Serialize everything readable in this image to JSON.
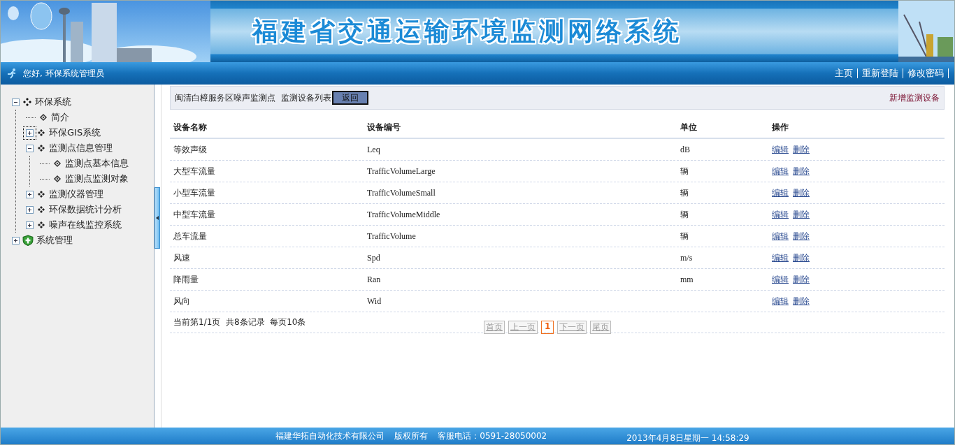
{
  "header": {
    "title": "福建省交通运输环境监测网络系统"
  },
  "nav": {
    "greeting": "您好, 环保系统管理员",
    "links": [
      {
        "label": "主页"
      },
      {
        "label": "重新登陆"
      },
      {
        "label": "修改密码"
      }
    ]
  },
  "tree": [
    {
      "label": "环保系统",
      "kind": "group",
      "expanded": true,
      "children": [
        {
          "label": "简介",
          "kind": "leaf"
        },
        {
          "label": "环保GIS系统",
          "kind": "node",
          "expanded": false,
          "focused": true
        },
        {
          "label": "监测点信息管理",
          "kind": "node",
          "expanded": true,
          "children": [
            {
              "label": "监测点基本信息",
              "kind": "leaf"
            },
            {
              "label": "监测点监测对象",
              "kind": "leaf"
            }
          ]
        },
        {
          "label": "监测仪器管理",
          "kind": "node",
          "expanded": false
        },
        {
          "label": "环保数据统计分析",
          "kind": "node",
          "expanded": false
        },
        {
          "label": "噪声在线监控系统",
          "kind": "node",
          "expanded": false
        }
      ]
    },
    {
      "label": "系统管理",
      "kind": "shield",
      "expanded": false
    }
  ],
  "toolbar": {
    "breadcrumb": "闽清白樟服务区噪声监测点  监测设备列表",
    "back_button": "返回",
    "add_link": "新增监测设备"
  },
  "table": {
    "columns": [
      "设备名称",
      "设备编号",
      "单位",
      "操作"
    ],
    "rows": [
      {
        "name": "等效声级",
        "code": "Leq",
        "unit": "dB",
        "actions": [
          "编辑",
          "删除"
        ]
      },
      {
        "name": "大型车流量",
        "code": "TrafficVolumeLarge",
        "unit": "辆",
        "actions": [
          "编辑",
          "删除"
        ]
      },
      {
        "name": "小型车流量",
        "code": "TrafficVolumeSmall",
        "unit": "辆",
        "actions": [
          "编辑",
          "删除"
        ]
      },
      {
        "name": "中型车流量",
        "code": "TrafficVolumeMiddle",
        "unit": "辆",
        "actions": [
          "编辑",
          "删除"
        ]
      },
      {
        "name": "总车流量",
        "code": "TrafficVolume",
        "unit": "辆",
        "actions": [
          "编辑",
          "删除"
        ]
      },
      {
        "name": "风速",
        "code": "Spd",
        "unit": "m/s",
        "actions": [
          "编辑",
          "删除"
        ]
      },
      {
        "name": "降雨量",
        "code": "Ran",
        "unit": "mm",
        "actions": [
          "编辑",
          "删除"
        ]
      },
      {
        "name": "风向",
        "code": "Wid",
        "actions": [
          "编辑",
          "删除"
        ]
      }
    ]
  },
  "pagination": {
    "summary": "当前第1/1页  共8条记录  每页10条",
    "pages": [
      {
        "label": "首页",
        "selected": false,
        "disabled": true
      },
      {
        "label": "上一页",
        "selected": false,
        "disabled": true
      },
      {
        "label": "1",
        "selected": true,
        "disabled": false
      },
      {
        "label": "下一页",
        "selected": false,
        "disabled": true
      },
      {
        "label": "尾页",
        "selected": false,
        "disabled": true
      }
    ]
  },
  "footer": {
    "company": "福建华拓自动化技术有限公司",
    "rights": "版权所有",
    "phone": "客服电话：0591-28050002",
    "datetime": "2013年4月8日星期一 14:58:29"
  }
}
